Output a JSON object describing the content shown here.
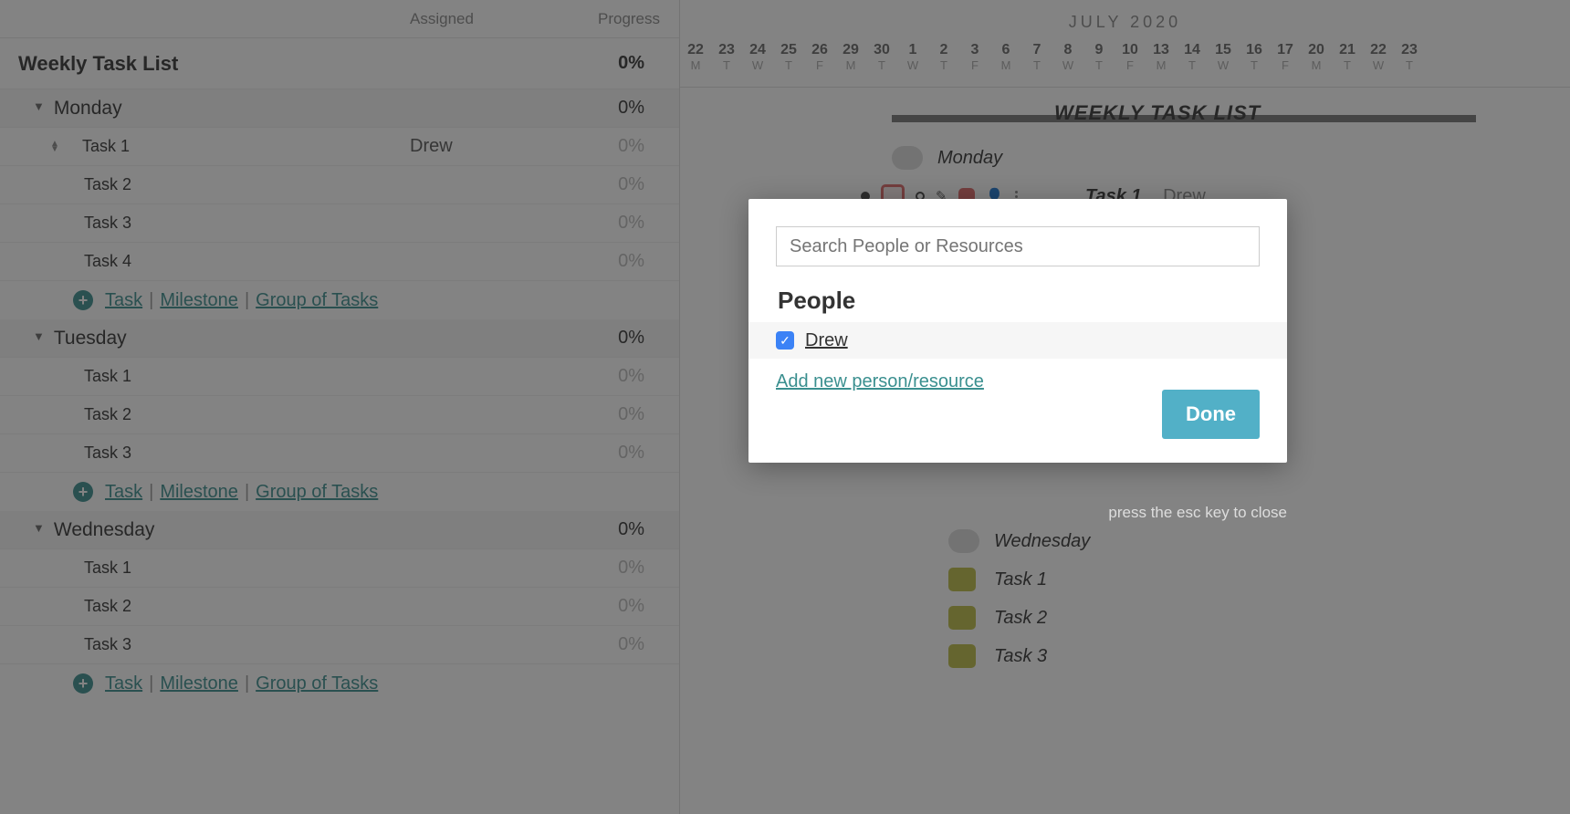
{
  "columns": {
    "assigned": "Assigned",
    "progress": "Progress"
  },
  "project": {
    "title": "Weekly Task List",
    "progress": "0%"
  },
  "addrow": {
    "task": "Task",
    "milestone": "Milestone",
    "group": "Group of Tasks"
  },
  "days": [
    {
      "n": "22",
      "l": "M"
    },
    {
      "n": "23",
      "l": "T"
    },
    {
      "n": "24",
      "l": "W"
    },
    {
      "n": "25",
      "l": "T"
    },
    {
      "n": "26",
      "l": "F"
    },
    {
      "n": "29",
      "l": "M"
    },
    {
      "n": "30",
      "l": "T"
    },
    {
      "n": "1",
      "l": "W"
    },
    {
      "n": "2",
      "l": "T"
    },
    {
      "n": "3",
      "l": "F"
    },
    {
      "n": "6",
      "l": "M"
    },
    {
      "n": "7",
      "l": "T"
    },
    {
      "n": "8",
      "l": "W"
    },
    {
      "n": "9",
      "l": "T"
    },
    {
      "n": "10",
      "l": "F"
    },
    {
      "n": "13",
      "l": "M"
    },
    {
      "n": "14",
      "l": "T"
    },
    {
      "n": "15",
      "l": "W"
    },
    {
      "n": "16",
      "l": "T"
    },
    {
      "n": "17",
      "l": "F"
    },
    {
      "n": "20",
      "l": "M"
    },
    {
      "n": "21",
      "l": "T"
    },
    {
      "n": "22",
      "l": "W"
    },
    {
      "n": "23",
      "l": "T"
    }
  ],
  "month": "JULY 2020",
  "groups": [
    {
      "name": "Monday",
      "progress": "0%",
      "tasks": [
        {
          "name": "Task 1",
          "assigned": "Drew",
          "progress": "0%"
        },
        {
          "name": "Task 2",
          "assigned": "",
          "progress": "0%"
        },
        {
          "name": "Task 3",
          "assigned": "",
          "progress": "0%"
        },
        {
          "name": "Task 4",
          "assigned": "",
          "progress": "0%"
        }
      ]
    },
    {
      "name": "Tuesday",
      "progress": "0%",
      "tasks": [
        {
          "name": "Task 1",
          "assigned": "",
          "progress": "0%"
        },
        {
          "name": "Task 2",
          "assigned": "",
          "progress": "0%"
        },
        {
          "name": "Task 3",
          "assigned": "",
          "progress": "0%"
        }
      ]
    },
    {
      "name": "Wednesday",
      "progress": "0%",
      "tasks": [
        {
          "name": "Task 1",
          "assigned": "",
          "progress": "0%"
        },
        {
          "name": "Task 2",
          "assigned": "",
          "progress": "0%"
        },
        {
          "name": "Task 3",
          "assigned": "",
          "progress": "0%"
        }
      ]
    }
  ],
  "gantt": {
    "title": "WEEKLY TASK LIST",
    "monday": "Monday",
    "task1": "Task 1",
    "task1_assignee": "Drew",
    "wednesday": "Wednesday",
    "wtask1": "Task 1",
    "wtask2": "Task 2",
    "wtask3": "Task 3"
  },
  "modal": {
    "search_placeholder": "Search People or Resources",
    "people_heading": "People",
    "person0": "Drew",
    "add_link": "Add new person/resource",
    "done": "Done",
    "esc_hint": "press the esc key to close"
  }
}
